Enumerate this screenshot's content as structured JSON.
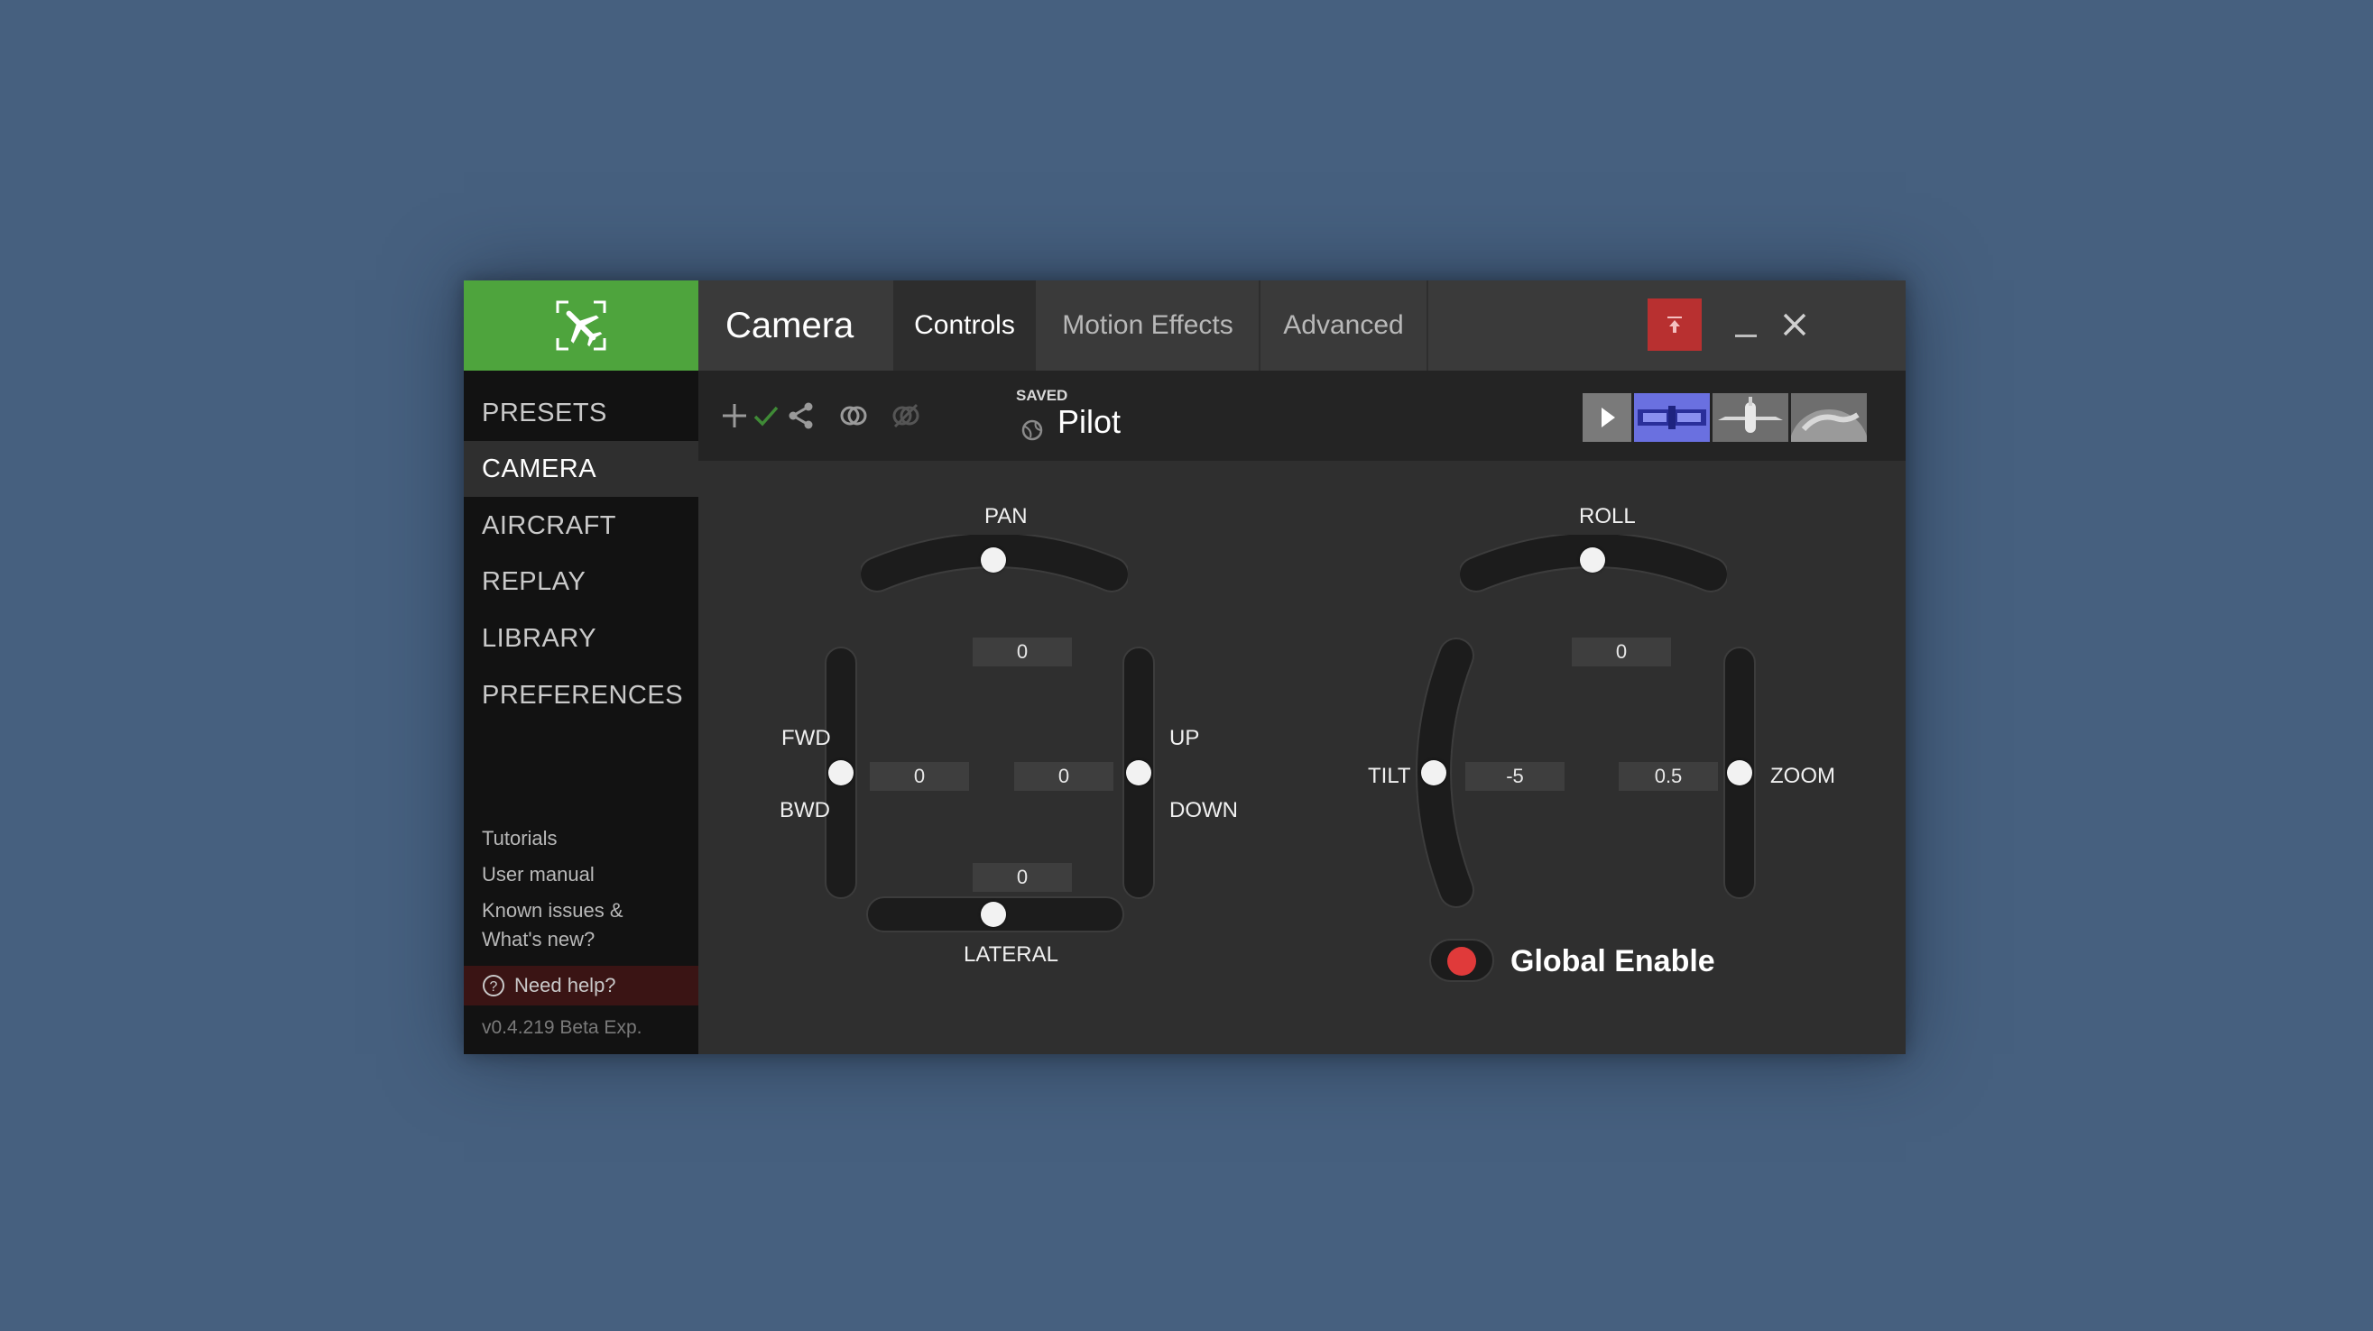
{
  "app": {
    "title": "Camera",
    "tabs": [
      {
        "label": "Controls",
        "active": true
      },
      {
        "label": "Motion Effects",
        "active": false
      },
      {
        "label": "Advanced",
        "active": false
      }
    ],
    "accent_color": "#4ea43d",
    "pin_color": "#b83030"
  },
  "sidebar": {
    "items": [
      {
        "label": "PRESETS",
        "active": false
      },
      {
        "label": "CAMERA",
        "active": true
      },
      {
        "label": "AIRCRAFT",
        "active": false
      },
      {
        "label": "REPLAY",
        "active": false
      },
      {
        "label": "LIBRARY",
        "active": false
      },
      {
        "label": "PREFERENCES",
        "active": false
      }
    ],
    "links": [
      "Tutorials",
      "User manual",
      "Known issues &",
      "What's new?"
    ],
    "need_help": "Need help?",
    "version": "v0.4.219 Beta Exp."
  },
  "toolbar": {
    "icons": [
      "plus-icon",
      "check-icon",
      "share-icon",
      "link-icon",
      "unlink-icon"
    ],
    "saved_label": "SAVED",
    "preset_name": "Pilot",
    "view_buttons": [
      "play-icon",
      "cockpit-view-icon",
      "aircraft-view-icon",
      "world-view-icon"
    ]
  },
  "controls": {
    "left": {
      "pan": {
        "label": "PAN",
        "value": "0"
      },
      "fwd_label": "FWD",
      "bwd_label": "BWD",
      "fwd_bwd_value": "0",
      "up_label": "UP",
      "down_label": "DOWN",
      "up_down_value": "0",
      "lateral": {
        "label": "LATERAL",
        "value": "0"
      }
    },
    "right": {
      "roll": {
        "label": "ROLL",
        "value": "0"
      },
      "tilt": {
        "label": "TILT",
        "value": "-5"
      },
      "zoom": {
        "label": "ZOOM",
        "value": "0.5"
      }
    },
    "global_enable": {
      "label": "Global Enable",
      "enabled": false,
      "color": "#e03a3a"
    }
  }
}
